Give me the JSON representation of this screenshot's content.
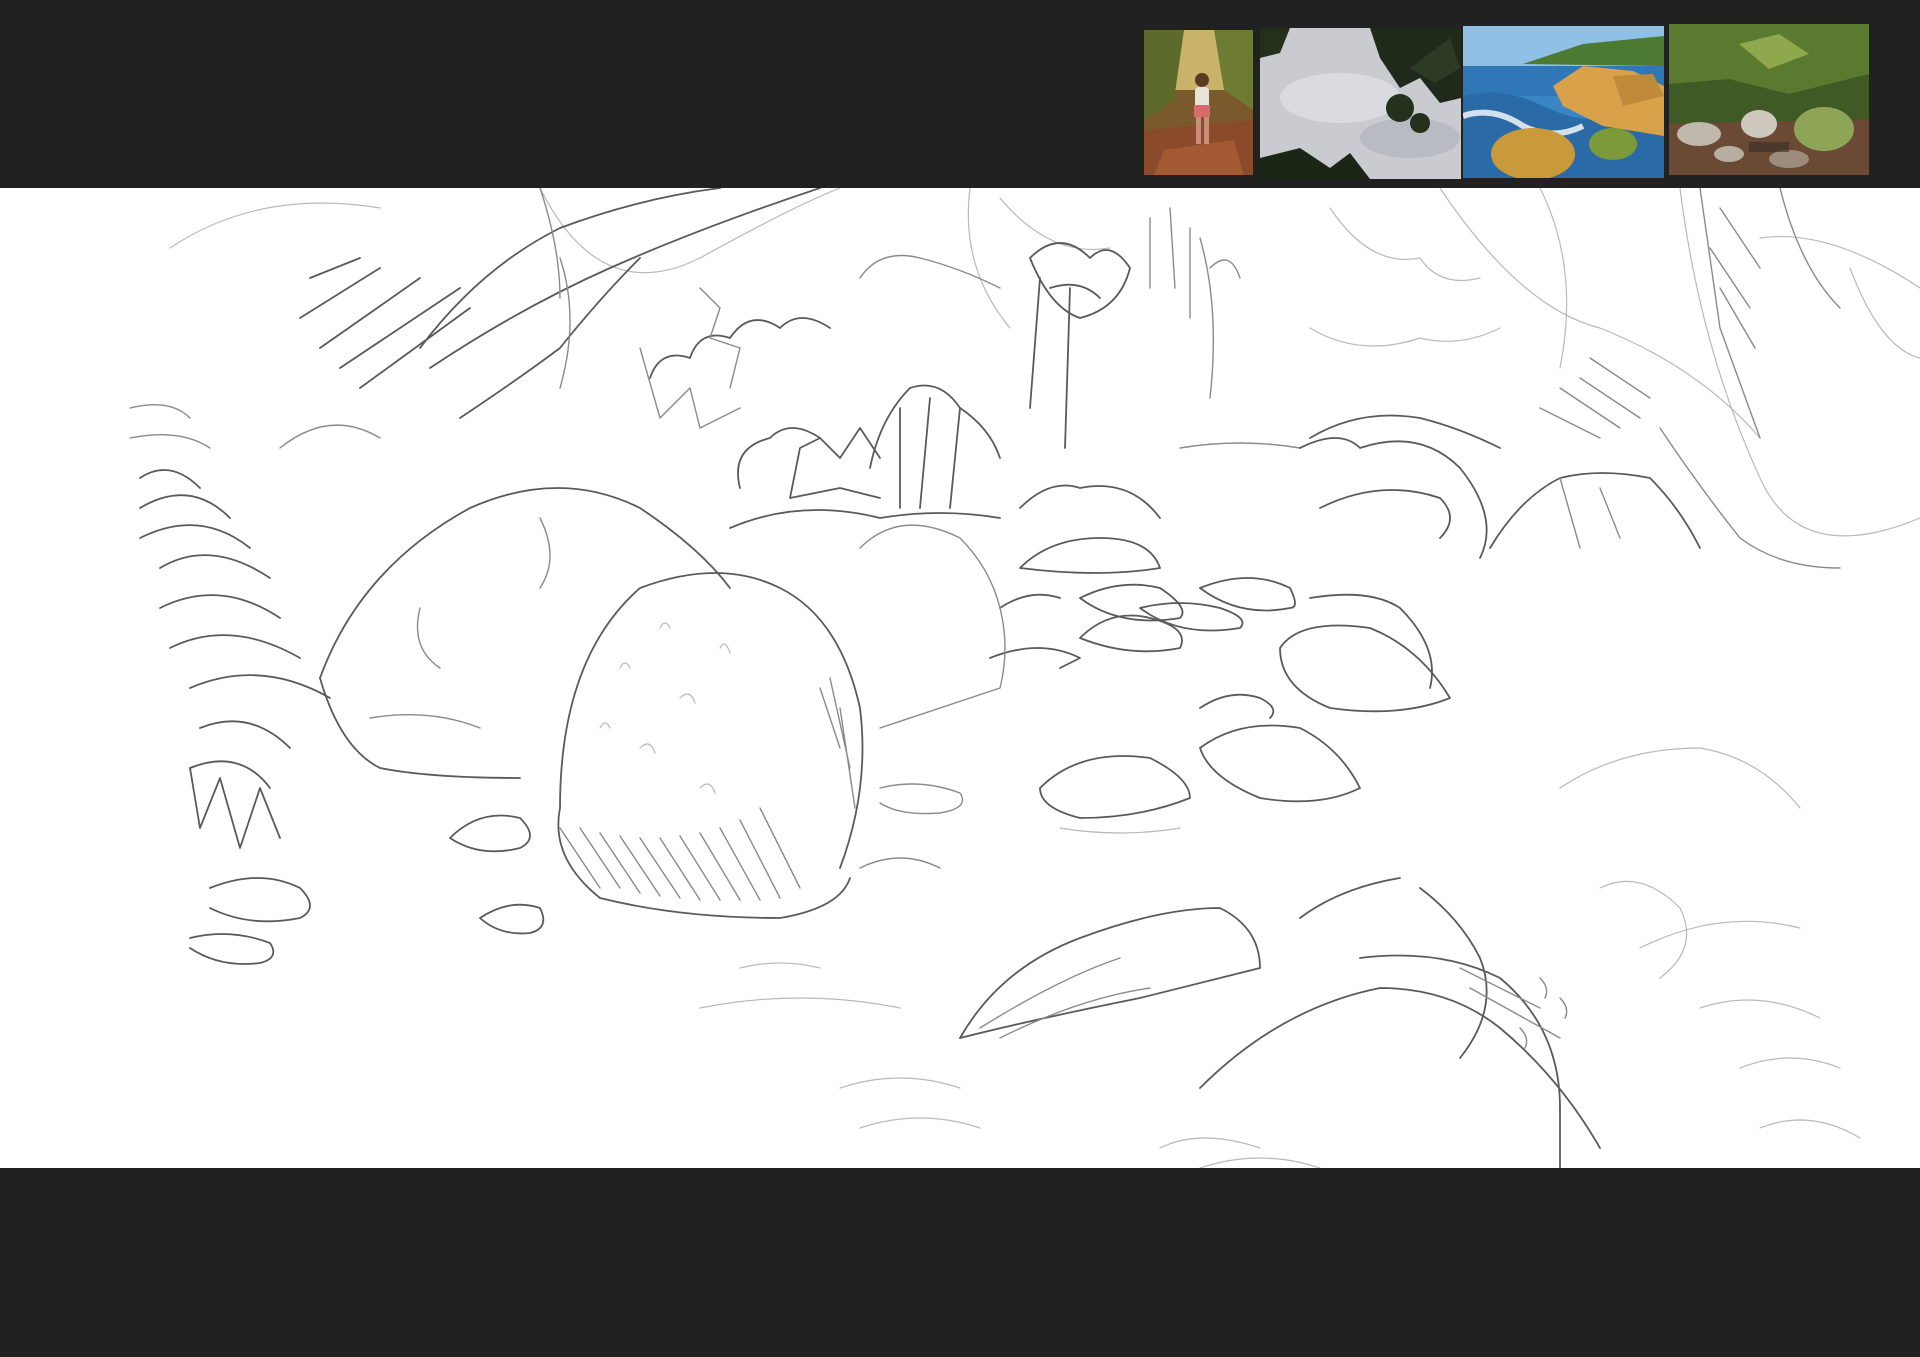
{
  "reference_panel": {
    "thumbnails": [
      {
        "subject": "hiker-on-forest-trail"
      },
      {
        "subject": "leaves-against-cloudy-sky"
      },
      {
        "subject": "rocky-coast-with-waves"
      },
      {
        "subject": "mossy-boulders-forest-stream"
      }
    ]
  },
  "canvas": {
    "background": "#ffffff",
    "frame_color": "#212121",
    "subject": "pencil-sketch-rocky-stream-in-forest"
  }
}
